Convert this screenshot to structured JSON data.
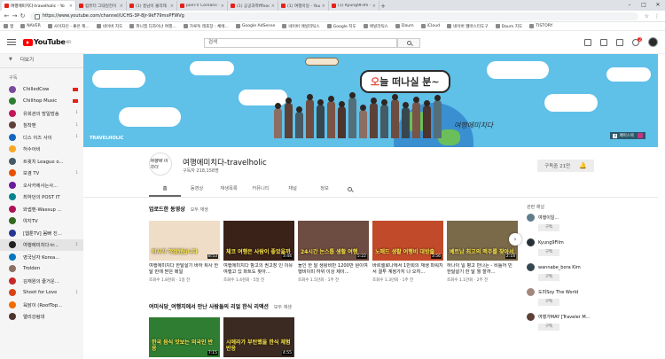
{
  "browser": {
    "tabs": [
      {
        "label": "여행에미치다-travelholic - Yo",
        "color": "#e62117",
        "active": true
      },
      {
        "label": "컴퓨터 그대일전이 예정을",
        "color": "#e62117"
      },
      {
        "label": "(1) 흥남이 볼리제 오른쪽",
        "color": "#e62117"
      },
      {
        "label": "poeTV Coreans - YouTube",
        "color": "#e62117"
      },
      {
        "label": "(1) 공공과학fffeechulism - Yo",
        "color": "#e62117"
      },
      {
        "label": "(1) 여행이일 - YouTube",
        "color": "#e62117"
      },
      {
        "label": "(1) Kyung9Film - YouTube",
        "color": "#e62117"
      }
    ],
    "url": "https://www.youtube.com/channel/UCHS-3P-8Jr-9kF79mxPFWVg",
    "bookmarks": [
      {
        "label": "앱"
      },
      {
        "label": "NAVER"
      },
      {
        "label": "사이자인 - 좋은 제..."
      },
      {
        "label": "네이버 지도"
      },
      {
        "label": "파니엠 디자이너 여행..."
      },
      {
        "label": "가루둑 레포장 : 체에..."
      },
      {
        "label": "Google AdSense"
      },
      {
        "label": "네이버 애널리틱스"
      },
      {
        "label": "Google 지도"
      },
      {
        "label": "애널리틱스"
      },
      {
        "label": "Daum"
      },
      {
        "label": "iCloud"
      },
      {
        "label": "네이버 웹마스터도구"
      },
      {
        "label": "Daum 지도"
      },
      {
        "label": "TISTORY"
      }
    ]
  },
  "header": {
    "logo": "YouTube",
    "logo_region": "KR",
    "search_placeholder": "검색",
    "notification_count": "2"
  },
  "sidebar": {
    "more": "더보기",
    "section": "구독",
    "items": [
      {
        "name": "ChilledCow",
        "color": "#7a4a9c",
        "live": true
      },
      {
        "name": "Chillhop Music",
        "color": "#2e7d32",
        "live": true
      },
      {
        "name": "유희관의 방일방송",
        "color": "#c2185b",
        "badge": "1"
      },
      {
        "name": "침착맨",
        "color": "#5d4037",
        "badge": "1"
      },
      {
        "name": "디스 이즈 사이",
        "color": "#1565c0",
        "badge": "1"
      },
      {
        "name": "허수아비",
        "color": "#f9a825"
      },
      {
        "name": "트윗치 League o...",
        "color": "#455a64"
      },
      {
        "name": "보겸 TV",
        "color": "#e65100",
        "badge": "1"
      },
      {
        "name": "오사카에사는사...",
        "color": "#6a1b9a"
      },
      {
        "name": "최하던의 POST IT",
        "color": "#00838f"
      },
      {
        "name": "와썹맨-Wassup ...",
        "color": "#ad1457"
      },
      {
        "name": "야지TV",
        "color": "#33691e"
      },
      {
        "name": "[웹툰TV] 몸빠 진...",
        "color": "#283593"
      },
      {
        "name": "여행에미치다-tr...",
        "color": "#212121",
        "selected": true,
        "badge": "1"
      },
      {
        "name": "영국남자 Korea...",
        "color": "#0277bd"
      },
      {
        "name": "Trolden",
        "color": "#8d6e63"
      },
      {
        "name": "김재원의 즐거운...",
        "color": "#c62828"
      },
      {
        "name": "Shoot for Love",
        "color": "#d84315",
        "badge": "1"
      },
      {
        "name": "육닭이 (RoofTop...",
        "color": "#ef6c00"
      },
      {
        "name": "앨리강림대",
        "color": "#4e342e"
      }
    ]
  },
  "banner": {
    "title_accent": "오",
    "title_rest": "늘 떠나실 분~",
    "brand": "TRAVELHOLIC",
    "signature": "여행에미치다",
    "social_label": "페이스북"
  },
  "channel": {
    "avatar_text": "여행에 미치다",
    "name": "여행에미치다-travelholic",
    "subscribers": "구독자 218,158명",
    "subscribe_label": "구독중 21만",
    "tabs": [
      "홈",
      "동영상",
      "재생목록",
      "커뮤니티",
      "채널",
      "정보"
    ]
  },
  "uploads": {
    "title": "업로드한 동영상",
    "play_all": "모두 재생",
    "videos": [
      {
        "caption": "퇴사가 확정됐습니다",
        "duration": "8:53",
        "title": "여행에미치다 한달살기 바하 퇴사 한 달 만에 받은 메일",
        "meta": "조회수 1.8천회 · 1일 전",
        "bg": "#f0ddc7"
      },
      {
        "caption": "체코 여행은 사람이 좋았을까",
        "duration": "3:44",
        "title": "여행에미치다 항고의 권고장 인 이유 여행고 있 파트도 찾아...",
        "meta": "조회수 1.4천회 · 5일 전",
        "bg": "#3a2218"
      },
      {
        "caption": "24시간 논스톱 생활 여행",
        "duration": "5:22",
        "title": "돌인 한 달 생활비만 1200만 원이여행비이미 하위 이상 제이...",
        "meta": "조회수 1.5만회 · 1주 전",
        "bg": "#6d4c41"
      },
      {
        "caption": "노매드 생활 여행비 대방출",
        "duration": "3:56",
        "title": "바르셀로나에서 1만회의 재생 파워지서 결투 계정가지 나 오히...",
        "meta": "조회수 1.3만회 · 1주 전",
        "bg": "#c14a2a"
      },
      {
        "caption": "베트남 최고의 맥주를 찾아서",
        "duration": "2:18",
        "title": "하나이 일 평고 만나는 - 비틀어 민 한달살기 한 달 뭘 할까...",
        "meta": "조회수 1.1만회 · 2주 전",
        "bg": "#7a6a4a"
      }
    ]
  },
  "playlist": {
    "title": "여미식당_여행지에서 만난 사람들의 리얼 한식 리액션",
    "play_all": "모두 재생",
    "videos": [
      {
        "caption": "한국 음식 맛보는 외국인 반응",
        "duration": "7:15",
        "bg": "#2e7d32"
      },
      {
        "caption": "시에라가 부탄했을 한식 체험 반응",
        "duration": "4:55",
        "bg": "#3b2a22"
      }
    ]
  },
  "related": {
    "title": "관련 채널",
    "subscribe_label": "구독",
    "channels": [
      {
        "name": "여행이일...",
        "color": "#607d8b"
      },
      {
        "name": "Kyung9Film",
        "color": "#263238"
      },
      {
        "name": "wannabe_bora Kim",
        "color": "#37474f"
      },
      {
        "name": "도미Soy The World",
        "color": "#a1887f"
      },
      {
        "name": "여행가MAY [Traveler M...",
        "color": "#5d4037"
      }
    ]
  }
}
